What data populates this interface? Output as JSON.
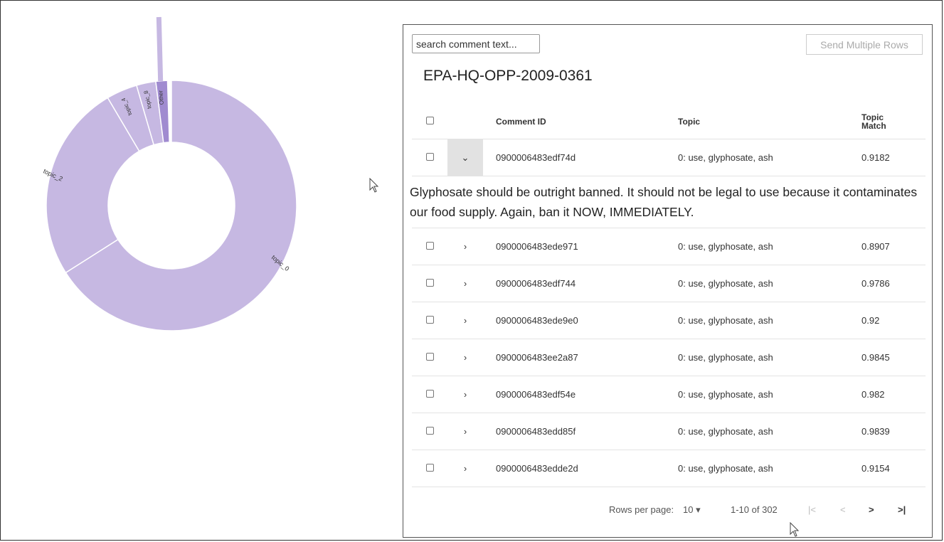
{
  "donut": {
    "fill_color": "#c6b8e2",
    "other_color": "#a08bd0",
    "segments": [
      {
        "label": "topic_0",
        "share": 0.66
      },
      {
        "label": "topic_2",
        "share": 0.255
      },
      {
        "label": "topic_4",
        "share": 0.04
      },
      {
        "label": "topic_8",
        "share": 0.025
      },
      {
        "label": "Other",
        "share": 0.015
      }
    ]
  },
  "search": {
    "placeholder": "search comment text..."
  },
  "toolbar": {
    "send_multiple_rows": "Send Multiple Rows"
  },
  "docket_id": "EPA-HQ-OPP-2009-0361",
  "table": {
    "columns": {
      "comment_id": "Comment ID",
      "topic": "Topic",
      "topic_match": "Topic Match"
    },
    "rows": [
      {
        "comment_id": "0900006483edf74d",
        "topic": "0: use, glyphosate, ash",
        "match": "0.9182",
        "expanded": true
      },
      {
        "comment_id": "0900006483ede971",
        "topic": "0: use, glyphosate, ash",
        "match": "0.8907"
      },
      {
        "comment_id": "0900006483edf744",
        "topic": "0: use, glyphosate, ash",
        "match": "0.9786"
      },
      {
        "comment_id": "0900006483ede9e0",
        "topic": "0: use, glyphosate, ash",
        "match": "0.92"
      },
      {
        "comment_id": "0900006483ee2a87",
        "topic": "0: use, glyphosate, ash",
        "match": "0.9845"
      },
      {
        "comment_id": "0900006483edf54e",
        "topic": "0: use, glyphosate, ash",
        "match": "0.982"
      },
      {
        "comment_id": "0900006483edd85f",
        "topic": "0: use, glyphosate, ash",
        "match": "0.9839"
      },
      {
        "comment_id": "0900006483edde2d",
        "topic": "0: use, glyphosate, ash",
        "match": "0.9154"
      }
    ],
    "expanded_text": "Glyphosate should be outright banned. It should not be legal to use because it contaminates our food supply. Again, ban it NOW, IMMEDIATELY."
  },
  "pagination": {
    "rows_per_page_label": "Rows per page:",
    "rows_per_page_value": "10 ▾",
    "range": "1-10 of 302",
    "first_icon": "|<",
    "prev_icon": "<",
    "next_icon": ">",
    "last_icon": ">|"
  }
}
